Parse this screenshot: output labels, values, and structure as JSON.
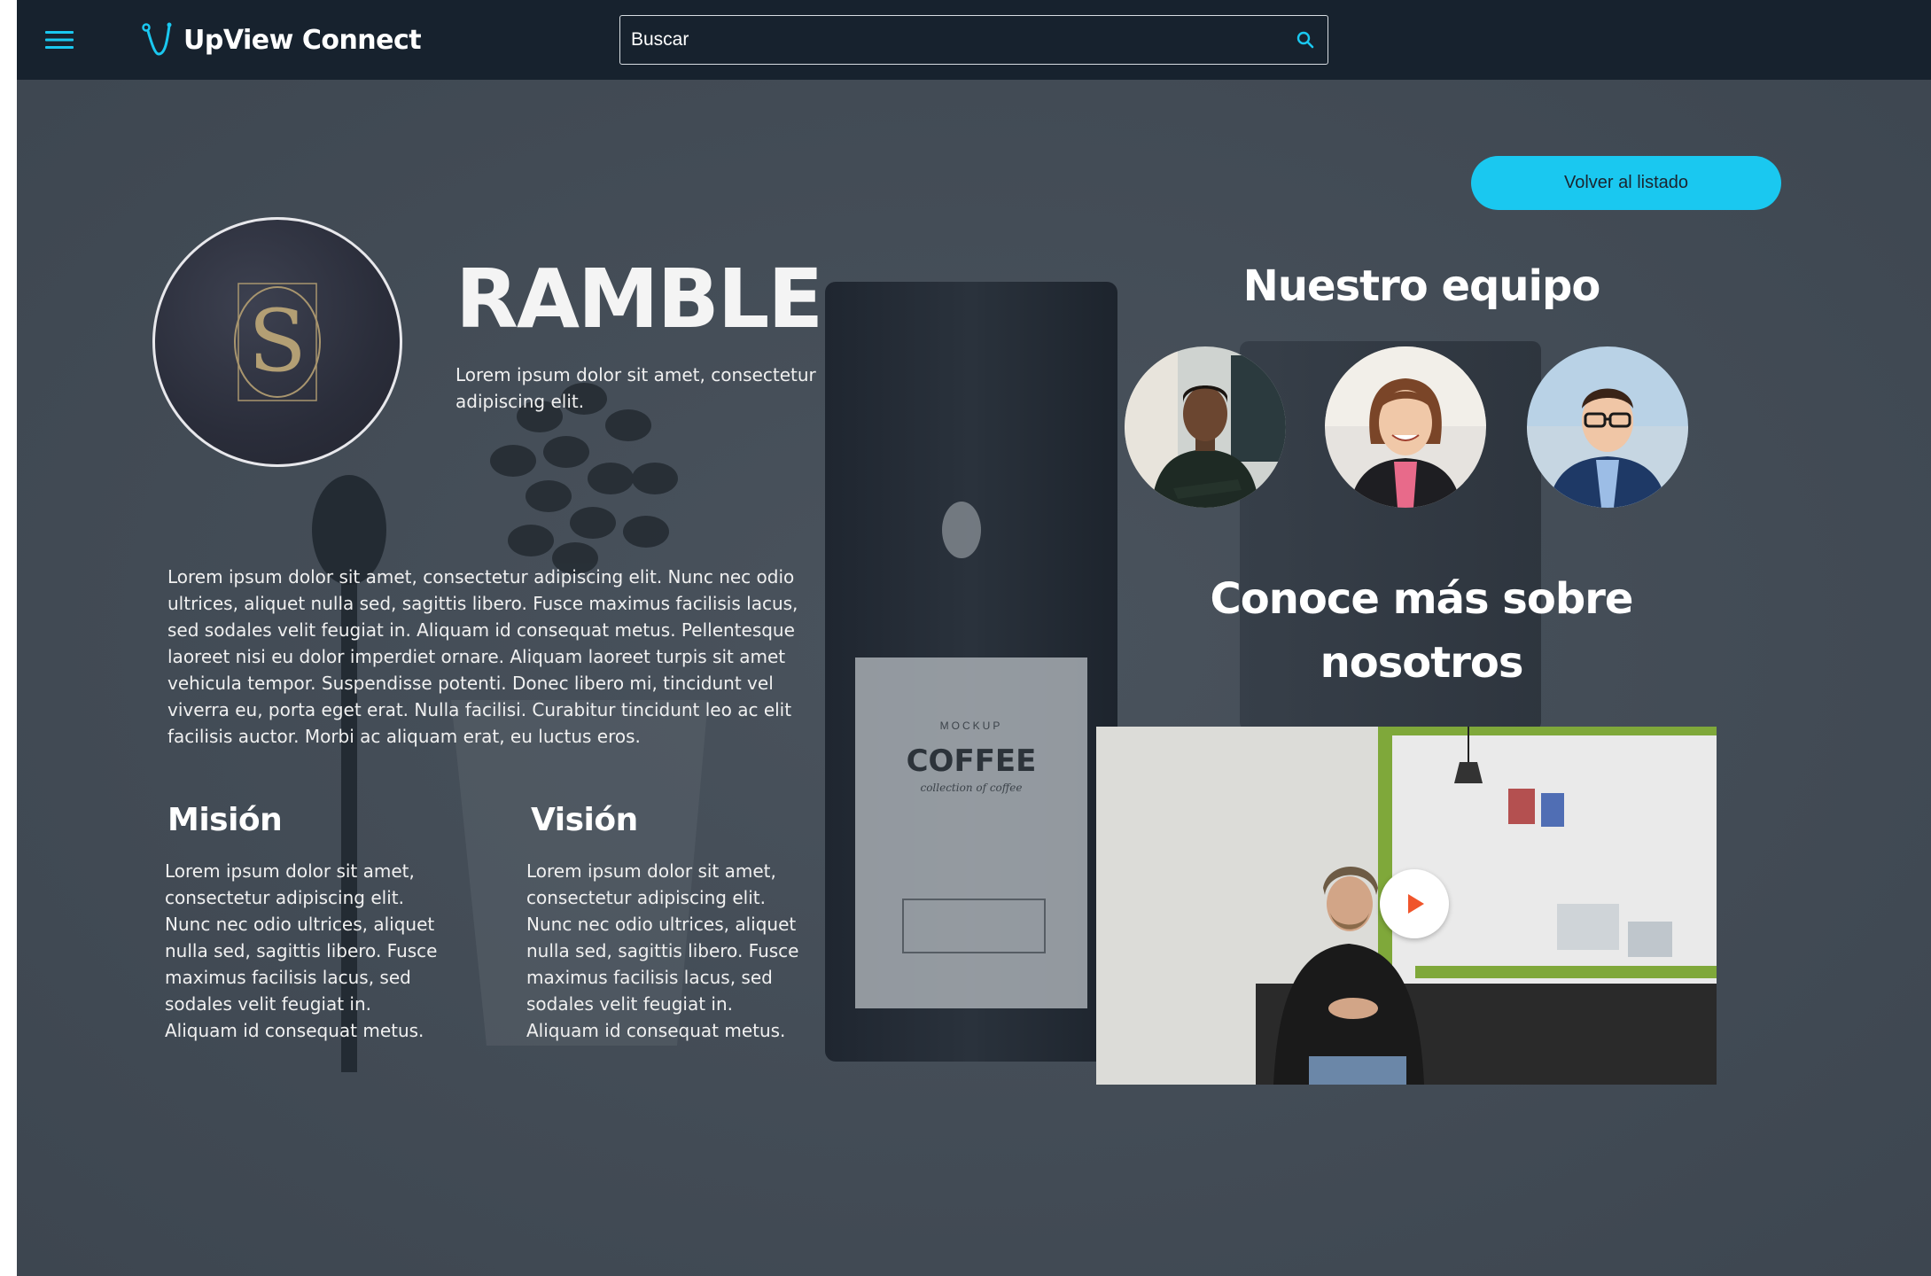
{
  "header": {
    "brand_name": "UpView Connect",
    "search_placeholder": "Buscar",
    "search_value": ""
  },
  "actions": {
    "back_label": "Volver al listado"
  },
  "company": {
    "name": "RAMBLE",
    "tagline": "Lorem ipsum dolor sit amet, consectetur adipiscing elit.",
    "description": "Lorem ipsum dolor sit amet, consectetur adipiscing elit. Nunc nec odio ultrices, aliquet nulla sed, sagittis libero. Fusce maximus facilisis lacus, sed sodales velit feugiat in. Aliquam id consequat metus. Pellentesque laoreet nisi eu dolor imperdiet ornare. Aliquam laoreet turpis sit amet vehicula tempor. Suspendisse potenti. Donec libero mi, tincidunt vel viverra eu, porta eget erat. Nulla facilisi. Curabitur tincidunt leo ac elit facilisis auctor. Morbi ac aliquam erat, eu luctus eros."
  },
  "mission": {
    "title": "Misión",
    "text": "Lorem ipsum dolor sit amet, consectetur adipiscing elit. Nunc nec odio ultrices, aliquet nulla sed, sagittis libero. Fusce maximus facilisis lacus, sed sodales velit feugiat in. Aliquam id consequat metus."
  },
  "vision": {
    "title": "Visión",
    "text": "Lorem ipsum dolor sit amet, consectetur adipiscing elit. Nunc nec odio ultrices, aliquet nulla sed, sagittis libero. Fusce maximus facilisis lacus, sed sodales velit feugiat in. Aliquam id consequat metus."
  },
  "team": {
    "title": "Nuestro equipo",
    "members": [
      "avatar-man-green-shirt",
      "avatar-woman-smiling",
      "avatar-man-glasses-suit"
    ]
  },
  "about": {
    "title": "Conoce más sobre nosotros",
    "video_icon": "play-icon"
  },
  "colors": {
    "topbar": "#17222e",
    "accent": "#1ac8f0",
    "background": "#444d57",
    "play": "#f0552b"
  },
  "background_labels": {
    "bag_brand_top": "MOCKUP",
    "bag_brand": "COFFEE",
    "bag_brand_sub": "collection of coffee"
  }
}
